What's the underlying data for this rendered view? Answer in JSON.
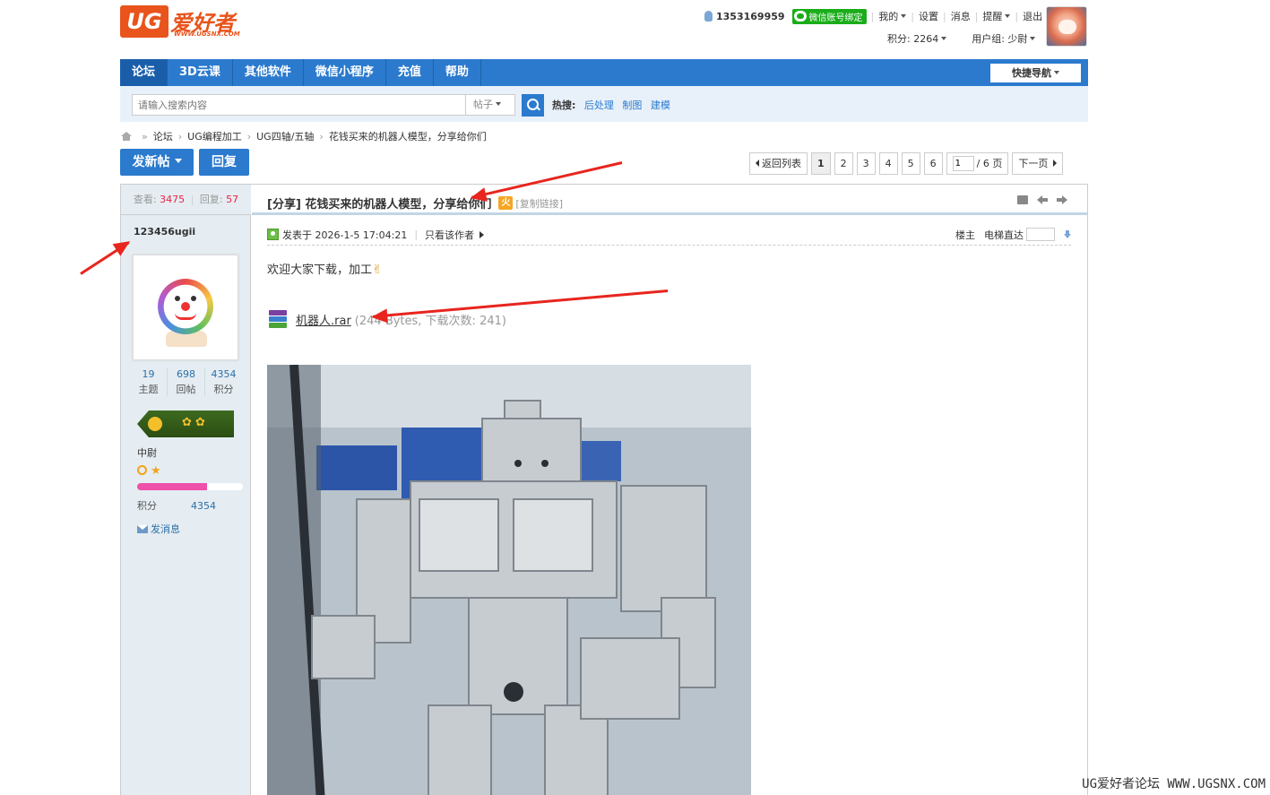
{
  "logo": {
    "mark": "UG",
    "cn": "爱好者",
    "url": "WWW.UGSNX.COM"
  },
  "userbar": {
    "uid": "1353169959",
    "wechat_bind": "微信账号绑定",
    "links": [
      "我的",
      "设置",
      "消息",
      "提醒",
      "退出"
    ],
    "score_label": "积分: 2264",
    "group_label": "用户组: 少尉"
  },
  "nav": {
    "items": [
      "论坛",
      "3D云课",
      "其他软件",
      "微信小程序",
      "充值",
      "帮助"
    ],
    "quick_nav": "快捷导航"
  },
  "search": {
    "placeholder": "请输入搜索内容",
    "type": "帖子",
    "hot_label": "热搜:",
    "hot_links": [
      "后处理",
      "制图",
      "建模"
    ]
  },
  "breadcrumb": [
    "论坛",
    "UG编程加工",
    "UG四轴/五轴",
    "花钱买来的机器人模型，分享给你们"
  ],
  "actions": {
    "new_post": "发新帖",
    "reply": "回复"
  },
  "pager": {
    "back": "返回列表",
    "pages": [
      "1",
      "2",
      "3",
      "4",
      "5",
      "6"
    ],
    "current": "1",
    "jump_value": "1",
    "total": "/ 6 页",
    "next": "下一页"
  },
  "thread": {
    "views_label": "查看:",
    "views": "3475",
    "replies_label": "回复:",
    "replies": "57",
    "title": "[分享] 花钱买来的机器人模型，分享给你们",
    "hot_icon": "火",
    "copy_link": "[复制链接]"
  },
  "author": {
    "name": "123456ugii",
    "stats": [
      {
        "value": "19",
        "label": "主题"
      },
      {
        "value": "698",
        "label": "回帖"
      },
      {
        "value": "4354",
        "label": "积分"
      }
    ],
    "rank": "中尉",
    "progress": 0.66,
    "score_label": "积分",
    "score_value": "4354",
    "pm": "发消息"
  },
  "post": {
    "posted": "发表于 2026-1-5 17:04:21",
    "only_author": "只看该作者",
    "floor": "楼主",
    "elevator": "电梯直达",
    "body": "欢迎大家下载，加工",
    "attachment_name": "机器人.rar",
    "attachment_meta": "(244 Bytes, 下载次数: 241)"
  },
  "colors": {
    "accent": "#2b7acd",
    "arrow": "#e8251e",
    "logo": "#e8541c"
  },
  "watermark": "UG爱好者论坛 WWW.UGSNX.COM"
}
